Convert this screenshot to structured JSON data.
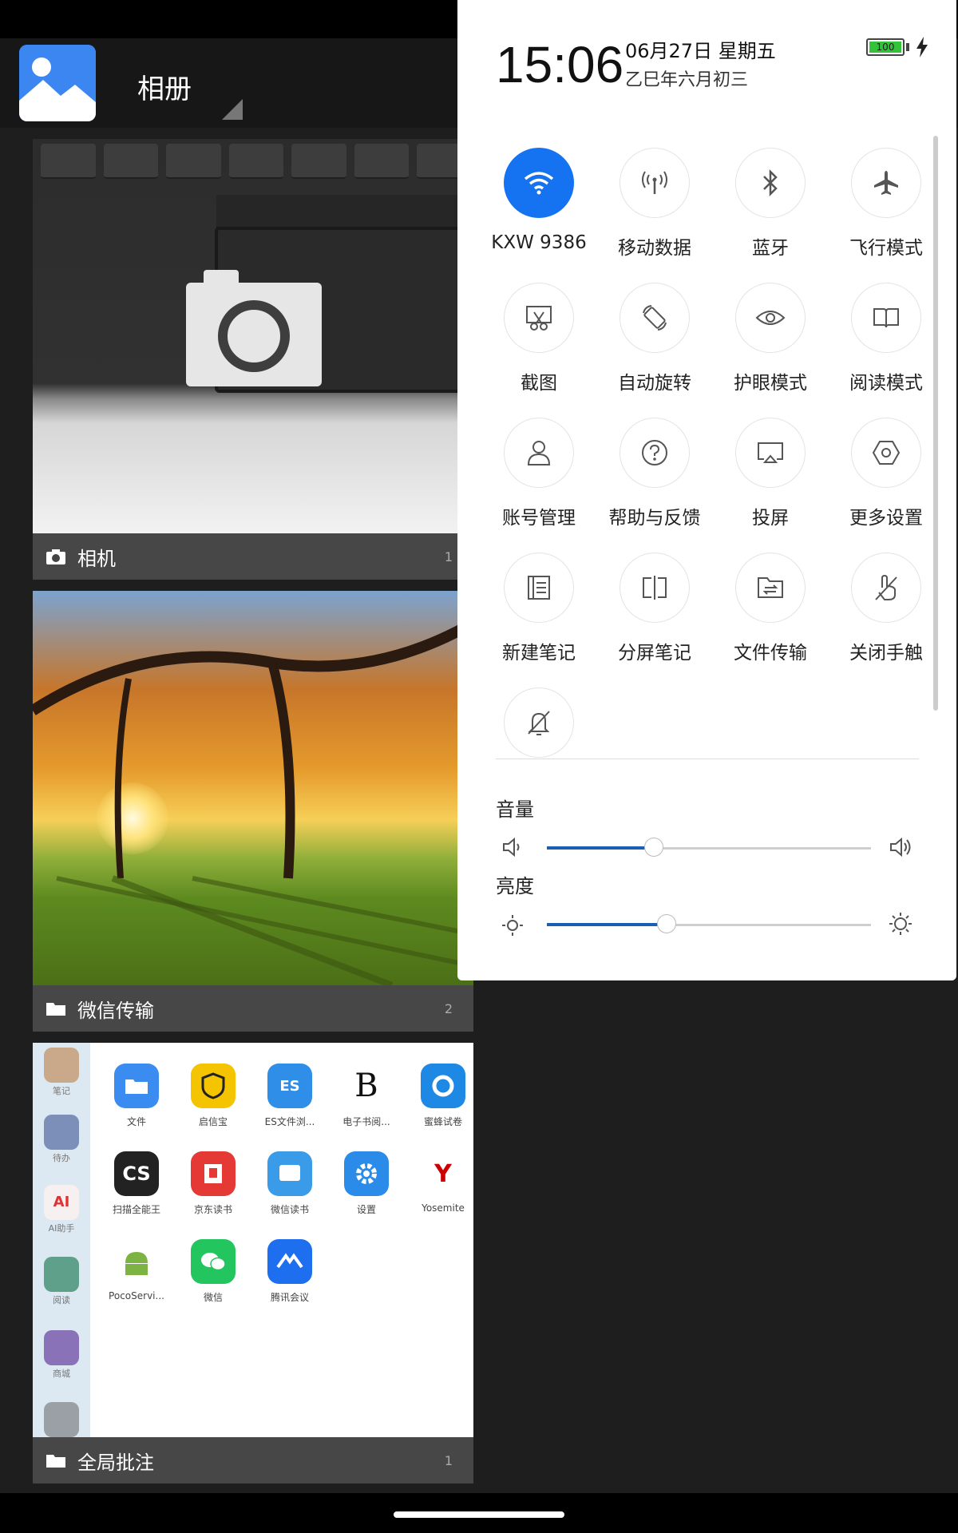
{
  "app": {
    "title": "相册"
  },
  "albums": [
    {
      "name": "相机",
      "count": "1"
    },
    {
      "name": "微信传输",
      "count": "2"
    },
    {
      "name": "全局批注",
      "count": "1"
    }
  ],
  "album3_preview": {
    "sidebar": [
      "笔记",
      "待办",
      "AI助手",
      "阅读",
      "商城",
      ""
    ],
    "apps": [
      {
        "name": "文件",
        "icon": "folder-icon",
        "color": "#3b8cf0"
      },
      {
        "name": "启信宝",
        "icon": "qixinbao-icon",
        "color": "#f5c400"
      },
      {
        "name": "ES文件浏...",
        "icon": "es-file-icon",
        "color": "#2f8ee8"
      },
      {
        "name": "电子书阅...",
        "icon": "ebook-icon",
        "color": "#ffffff"
      },
      {
        "name": "蜜蜂试卷",
        "icon": "exam-icon",
        "color": "#1e88e5"
      },
      {
        "name": "扫描全能王",
        "icon": "camscanner-icon",
        "color": "#222222"
      },
      {
        "name": "京东读书",
        "icon": "jd-read-icon",
        "color": "#e53935"
      },
      {
        "name": "微信读书",
        "icon": "weread-icon",
        "color": "#3a9be8"
      },
      {
        "name": "设置",
        "icon": "settings-icon",
        "color": "#2a8be8"
      },
      {
        "name": "Yosemite",
        "icon": "yosemite-icon",
        "color": "#ffffff"
      },
      {
        "name": "PocoServi...",
        "icon": "android-icon",
        "color": "#ffffff"
      },
      {
        "name": "微信",
        "icon": "wechat-icon",
        "color": "#22c55e"
      },
      {
        "name": "腾讯会议",
        "icon": "tencent-meeting-icon",
        "color": "#1e6ff0"
      }
    ]
  },
  "status": {
    "time": "15:06",
    "date": "06月27日 星期五",
    "lunar": "乙巳年六月初三",
    "battery": "100"
  },
  "tiles": [
    {
      "label": "KXW 9386",
      "icon": "wifi-icon",
      "on": true
    },
    {
      "label": "移动数据",
      "icon": "mobile-data-icon",
      "on": false
    },
    {
      "label": "蓝牙",
      "icon": "bluetooth-icon",
      "on": false
    },
    {
      "label": "飞行模式",
      "icon": "airplane-icon",
      "on": false
    },
    {
      "label": "截图",
      "icon": "screenshot-icon",
      "on": false
    },
    {
      "label": "自动旋转",
      "icon": "auto-rotate-icon",
      "on": false
    },
    {
      "label": "护眼模式",
      "icon": "eye-icon",
      "on": false
    },
    {
      "label": "阅读模式",
      "icon": "book-icon",
      "on": false
    },
    {
      "label": "账号管理",
      "icon": "account-icon",
      "on": false
    },
    {
      "label": "帮助与反馈",
      "icon": "help-icon",
      "on": false
    },
    {
      "label": "投屏",
      "icon": "cast-icon",
      "on": false
    },
    {
      "label": "更多设置",
      "icon": "settings-hex-icon",
      "on": false
    },
    {
      "label": "新建笔记",
      "icon": "new-note-icon",
      "on": false
    },
    {
      "label": "分屏笔记",
      "icon": "split-note-icon",
      "on": false
    },
    {
      "label": "文件传输",
      "icon": "file-transfer-icon",
      "on": false
    },
    {
      "label": "关闭手触",
      "icon": "touch-off-icon",
      "on": false
    },
    {
      "label": "",
      "icon": "notification-off-icon",
      "on": false
    }
  ],
  "volume": {
    "label": "音量",
    "level": 0.33
  },
  "brightness": {
    "label": "亮度",
    "level": 0.37
  },
  "colors": {
    "accent": "#1573f2",
    "slider": "#1a5fb4"
  }
}
